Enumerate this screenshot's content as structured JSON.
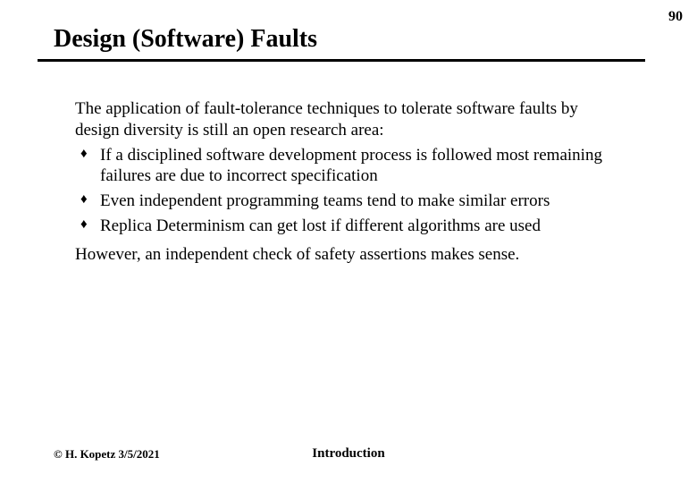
{
  "page_number": "90",
  "title": "Design (Software) Faults",
  "intro": "The application of fault-tolerance techniques to tolerate software faults by design diversity is still an open research area:",
  "bullets": [
    "If a disciplined software development process is followed most remaining failures are due to incorrect specification",
    "Even independent programming teams tend to make similar errors",
    "Replica Determinism can get  lost if different algorithms are used"
  ],
  "closing": "However, an independent check of safety assertions makes sense.",
  "footer_left": "© H. Kopetz 3/5/2021",
  "footer_center": "Introduction"
}
